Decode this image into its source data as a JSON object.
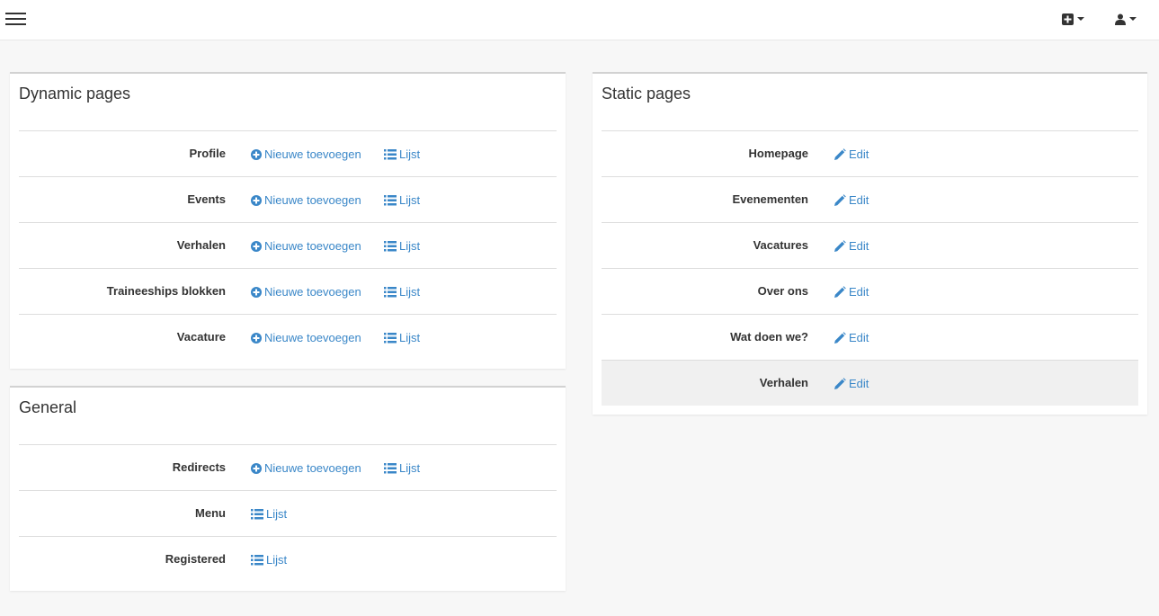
{
  "topbar": {
    "menu_icon": "hamburger-icon",
    "add_icon": "plus-square-icon",
    "user_icon": "user-icon"
  },
  "dynamic_pages": {
    "title": "Dynamic pages",
    "rows": [
      {
        "label": "Profile",
        "add": "Nieuwe toevoegen",
        "list": "Lijst"
      },
      {
        "label": "Events",
        "add": "Nieuwe toevoegen",
        "list": "Lijst"
      },
      {
        "label": "Verhalen",
        "add": "Nieuwe toevoegen",
        "list": "Lijst"
      },
      {
        "label": "Traineeships blokken",
        "add": "Nieuwe toevoegen",
        "list": "Lijst"
      },
      {
        "label": "Vacature",
        "add": "Nieuwe toevoegen",
        "list": "Lijst"
      }
    ]
  },
  "general": {
    "title": "General",
    "rows": [
      {
        "label": "Redirects",
        "add": "Nieuwe toevoegen",
        "list": "Lijst"
      },
      {
        "label": "Menu",
        "list": "Lijst"
      },
      {
        "label": "Registered",
        "list": "Lijst"
      }
    ]
  },
  "static_pages": {
    "title": "Static pages",
    "rows": [
      {
        "label": "Homepage",
        "edit": "Edit"
      },
      {
        "label": "Evenementen",
        "edit": "Edit"
      },
      {
        "label": "Vacatures",
        "edit": "Edit"
      },
      {
        "label": "Over ons",
        "edit": "Edit"
      },
      {
        "label": "Wat doen we?",
        "edit": "Edit"
      },
      {
        "label": "Verhalen",
        "edit": "Edit"
      }
    ]
  },
  "colors": {
    "link": "#3a87c8",
    "background": "#f7f7f7",
    "row_highlight": "#f0f0f0"
  }
}
